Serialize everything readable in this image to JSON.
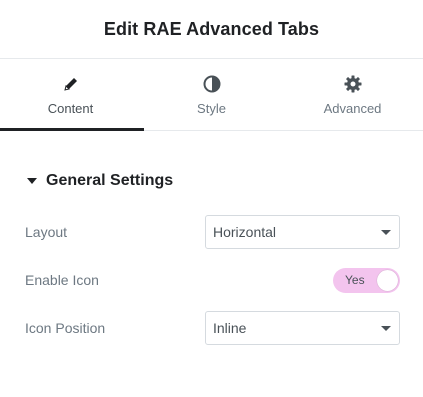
{
  "header": {
    "title": "Edit RAE Advanced Tabs"
  },
  "tabs": [
    {
      "label": "Content",
      "icon": "pencil-icon",
      "active": true
    },
    {
      "label": "Style",
      "icon": "half-circle-icon",
      "active": false
    },
    {
      "label": "Advanced",
      "icon": "gear-icon",
      "active": false
    }
  ],
  "section": {
    "title": "General Settings",
    "expanded": true
  },
  "controls": {
    "layout": {
      "label": "Layout",
      "value": "Horizontal"
    },
    "enable_icon": {
      "label": "Enable Icon",
      "toggle_text": "Yes",
      "on": true
    },
    "icon_position": {
      "label": "Icon Position",
      "value": "Inline"
    }
  },
  "colors": {
    "toggle_on": "#f3c4ee",
    "active_tab_underline": "#1f2124"
  }
}
